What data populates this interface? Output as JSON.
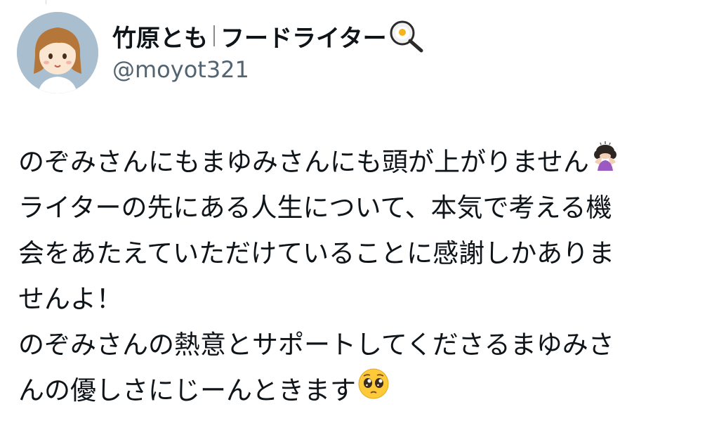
{
  "tweet": {
    "author": {
      "display_name": "竹原とも",
      "display_name_suffix": "フードライター",
      "handle": "@moyot321",
      "avatar_icon": "avatar-illustration-icon",
      "name_emoji_icon": "frying-pan-egg-icon"
    },
    "lines": [
      "のぞみさんにもまゆみさんにも頭が上がりません",
      "ライターの先にある人生について、本気で考える機",
      "会をあたえていただけていることに感謝しかありま",
      "せんよ！",
      "のぞみさんの熱意とサポートしてくださるまゆみさ",
      "んの優しさにじーんときます"
    ],
    "line_end_emojis": {
      "0": "person-bowing-icon",
      "5": "pleading-face-icon"
    }
  },
  "colors": {
    "text": "#0f1419",
    "secondary_text": "#536471",
    "avatar_bg": "#a9bfd0"
  }
}
